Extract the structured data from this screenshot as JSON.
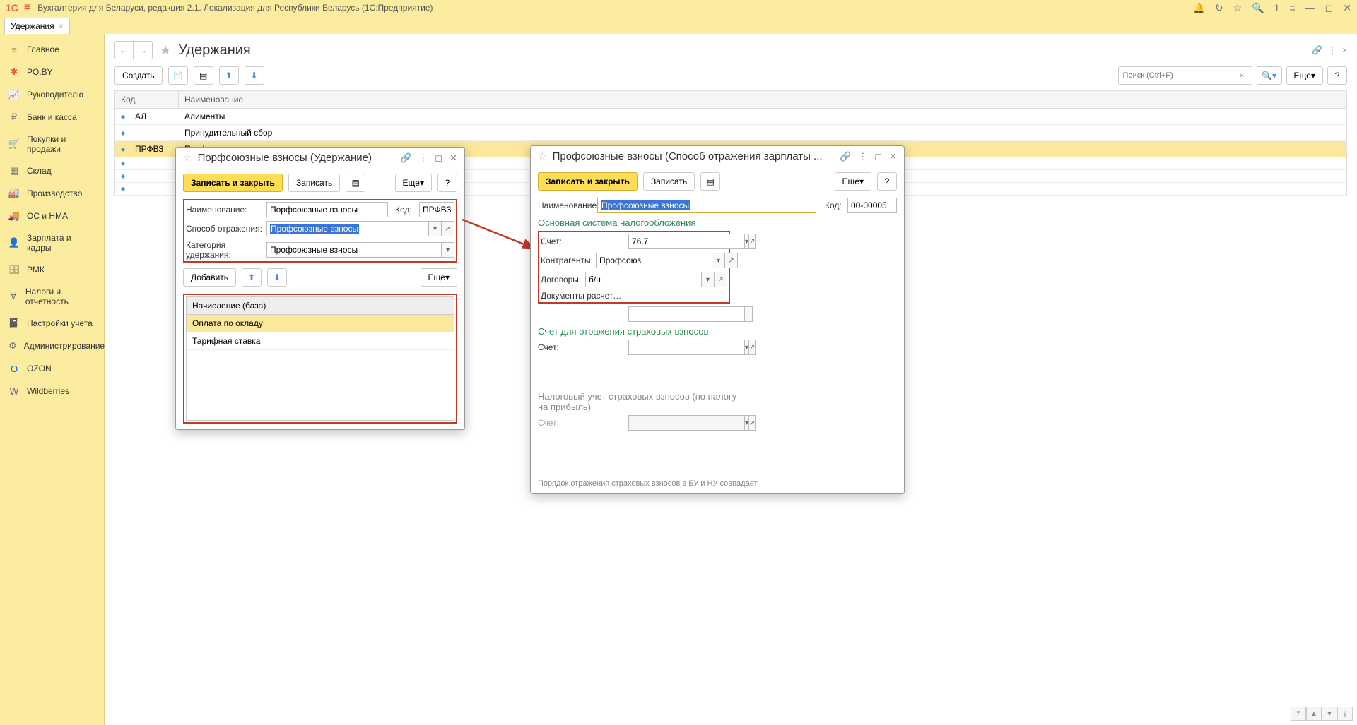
{
  "titlebar": {
    "logo": "1С",
    "title": "Бухгалтерия для Беларуси, редакция 2.1. Локализация для Республики Беларусь   (1С:Предприятие)",
    "search_count": "1"
  },
  "tab": {
    "label": "Удержания"
  },
  "sidebar": {
    "items": [
      {
        "icon": "≡",
        "label": "Главное",
        "color": "#d4a040"
      },
      {
        "icon": "✱",
        "label": "PO.BY",
        "color": "#e8594a"
      },
      {
        "icon": "📈",
        "label": "Руководителю",
        "color": "#777"
      },
      {
        "icon": "₽",
        "label": "Банк и касса",
        "color": "#777"
      },
      {
        "icon": "🛒",
        "label": "Покупки и продажи",
        "color": "#777"
      },
      {
        "icon": "▦",
        "label": "Склад",
        "color": "#777"
      },
      {
        "icon": "🏭",
        "label": "Производство",
        "color": "#777"
      },
      {
        "icon": "🚚",
        "label": "ОС и НМА",
        "color": "#777"
      },
      {
        "icon": "👤",
        "label": "Зарплата и кадры",
        "color": "#777"
      },
      {
        "icon": "🗄",
        "label": "РМК",
        "color": "#777"
      },
      {
        "icon": "Ɐ",
        "label": "Налоги и отчетность",
        "color": "#777"
      },
      {
        "icon": "📓",
        "label": "Настройки учета",
        "color": "#777"
      },
      {
        "icon": "⚙",
        "label": "Администрирование",
        "color": "#777"
      },
      {
        "icon": "O",
        "label": "OZON",
        "color": "#0066d6"
      },
      {
        "icon": "W",
        "label": "Wildberries",
        "color": "#8e44ad"
      }
    ]
  },
  "page": {
    "title": "Удержания",
    "create_label": "Создать",
    "search_placeholder": "Поиск (Ctrl+F)",
    "more_label": "Еще",
    "help_label": "?",
    "columns": {
      "code": "Код",
      "name": "Наименование"
    },
    "rows": [
      {
        "code": "АЛ",
        "name": "Алименты"
      },
      {
        "code": "",
        "name": "Принудительный сбор"
      },
      {
        "code": "ПРФВЗ",
        "name": "Порфсоюзные взносы",
        "selected": true
      },
      {
        "code": "",
        "name": ""
      },
      {
        "code": "",
        "name": ""
      },
      {
        "code": "",
        "name": ""
      }
    ]
  },
  "dialog1": {
    "title": "Порфсоюзные взносы (Удержание)",
    "save_close": "Записать и закрыть",
    "save": "Записать",
    "more": "Еще",
    "help": "?",
    "labels": {
      "name": "Наименование:",
      "code": "Код:",
      "method": "Способ отражения:",
      "category": "Категория удержания:",
      "add": "Добавить",
      "list_header": "Начисление (база)"
    },
    "values": {
      "name": "Порфсоюзные взносы",
      "code": "ПРФВЗ",
      "method": "Профсоюзные взносы",
      "category": "Профсоюзные взносы"
    },
    "list": [
      "Оплата по окладу",
      "Тарифная ставка"
    ]
  },
  "dialog2": {
    "title": "Профсоюзные взносы (Способ отражения зарплаты ...",
    "save_close": "Записать и закрыть",
    "save": "Записать",
    "more": "Еще",
    "help": "?",
    "labels": {
      "name": "Наименование:",
      "code": "Код:",
      "section1": "Основная система налогообложения",
      "account": "Счет:",
      "contragent": "Контрагенты:",
      "contract": "Договоры:",
      "docs": "Документы расчетов с...",
      "section2": "Счет для отражения страховых взносов",
      "section3": "Налоговый учет страховых взносов (по налогу на прибыль)",
      "footnote": "Порядок отражения страховых взносов в БУ и НУ совпадает"
    },
    "values": {
      "name": "Профсоюзные взносы",
      "code": "00-00005",
      "account": "76.7",
      "contragent": "Профсоюз",
      "contract": "б/н"
    }
  }
}
